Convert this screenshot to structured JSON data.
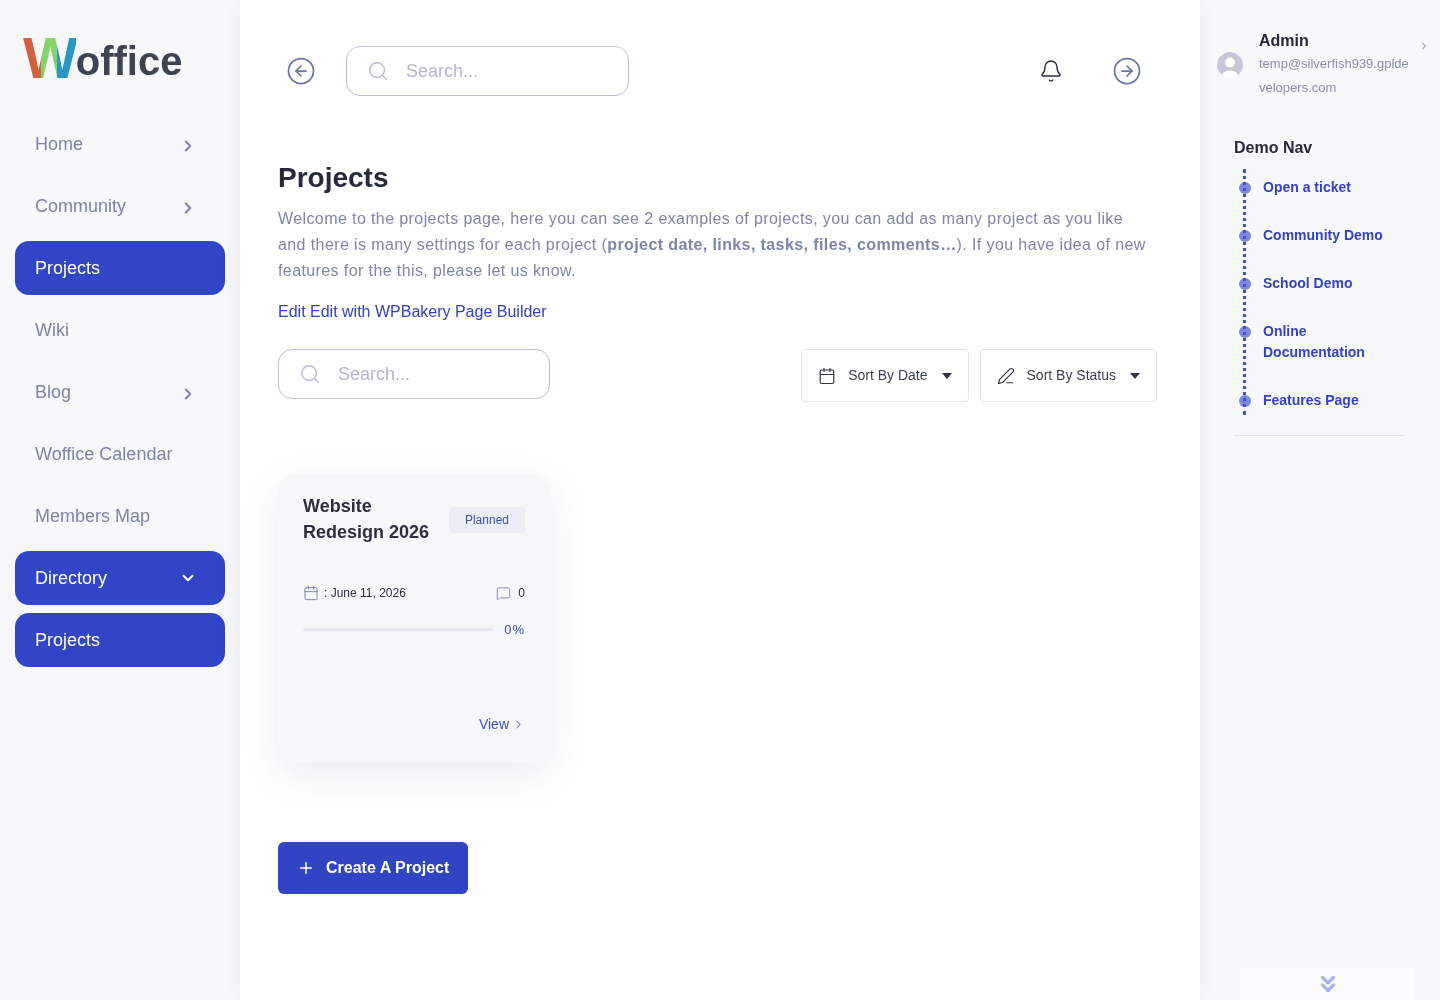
{
  "sidebar": {
    "logo": {
      "mark": "W",
      "text": "office"
    },
    "items": [
      {
        "label": "Home",
        "kind": "submenu",
        "expanded": false,
        "selected": false
      },
      {
        "label": "Community",
        "kind": "submenu",
        "expanded": false,
        "selected": false
      },
      {
        "label": "Projects",
        "kind": "link",
        "selected": true
      },
      {
        "label": "Wiki",
        "kind": "link",
        "selected": false
      },
      {
        "label": "Blog",
        "kind": "submenu",
        "expanded": false,
        "selected": false
      },
      {
        "label": "Woffice Calendar",
        "kind": "link",
        "selected": false
      },
      {
        "label": "Members Map",
        "kind": "link",
        "selected": false
      },
      {
        "label": "Directory",
        "kind": "submenu",
        "expanded": true,
        "selected": true,
        "children": [
          {
            "label": "Projects",
            "kind": "link",
            "selected": true
          }
        ]
      }
    ]
  },
  "top_bar": {
    "search": {
      "placeholder": "Search..."
    }
  },
  "page": {
    "title": "Projects",
    "description": "Welcome to the projects page, here you can see 2 examples of projects, you can add as many project as you like and there is many settings for each project (**project date, links, tasks, files, comments…**). If you have idea of new features for the this, please let us know.",
    "edit_link": "Edit Edit with WPBakery Page Builder",
    "filters": {
      "search": {
        "placeholder": "Search..."
      },
      "sort_buttons": [
        {
          "kind": "date",
          "label": "Sort By Date"
        },
        {
          "kind": "status",
          "label": "Sort By Status"
        }
      ]
    },
    "projects": [
      {
        "title": "Website Redesign 2026",
        "status": "Planned",
        "date": ": June 11, 2026",
        "comments": "0",
        "level": 0,
        "reading": "0%",
        "link": "View"
      }
    ],
    "create_button": "Create A Project"
  },
  "user_panel": {
    "name": "Admin",
    "email": "temp@silverfish939.gpldevelopers.com"
  },
  "demo_nav": {
    "title": "Demo Nav",
    "items": [
      "Open a ticket",
      "Community Demo",
      "School Demo",
      "Online Documentation",
      "Features Page"
    ]
  }
}
